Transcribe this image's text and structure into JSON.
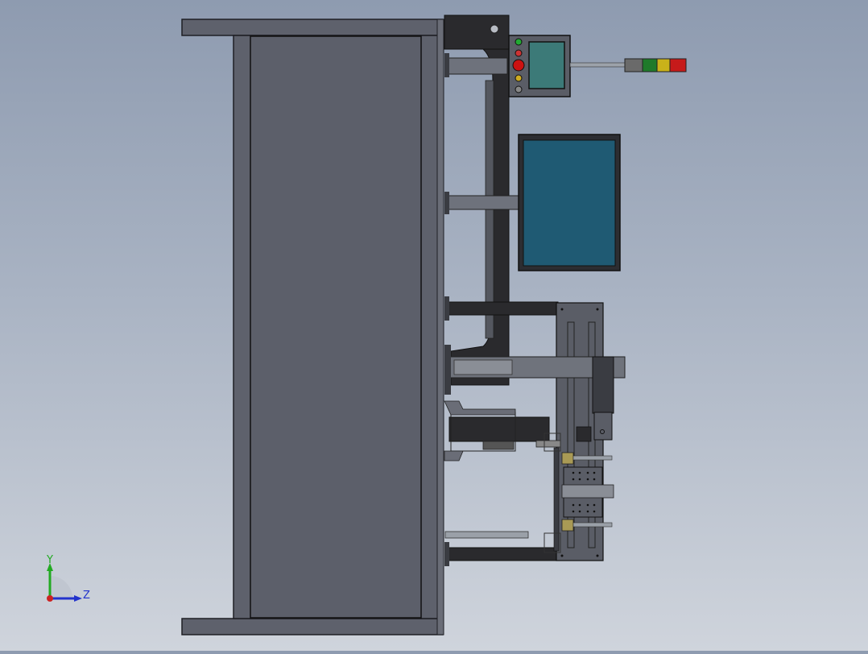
{
  "triad": {
    "y_label": "Y",
    "z_label": "Z"
  },
  "colors": {
    "background_top": "#8e9bb0",
    "background_bottom": "#cfd4dc",
    "frame_fill": "#5e616c",
    "frame_outline": "#1e1f24",
    "panel_fill": "#5c5f6a",
    "bracket_fill": "#2a2a2d",
    "monitor_screen": "#1f5a73",
    "hmi_screen": "#3c7a78",
    "axis_y": "#22aa22",
    "axis_z": "#2233cc",
    "origin": "#cc2222"
  },
  "stack_light": {
    "segments": [
      "gray",
      "green",
      "yellow",
      "red"
    ],
    "segment_colors": [
      "#6a6a6a",
      "#1f7a2a",
      "#c9b21a",
      "#c61a1a"
    ]
  },
  "control_buttons": {
    "buttons": [
      "green",
      "red",
      "red-large",
      "yellow",
      "gray"
    ],
    "button_colors": [
      "#22aa33",
      "#cc3333",
      "#cc1111",
      "#ccaa22",
      "#888888"
    ]
  }
}
